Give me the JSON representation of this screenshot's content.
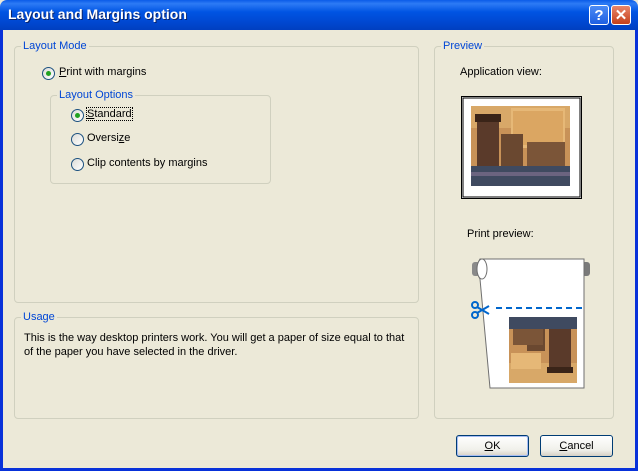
{
  "window": {
    "title": "Layout and Margins option",
    "help_glyph": "?",
    "close_glyph": "✕"
  },
  "layout_mode": {
    "legend": "Layout Mode",
    "print_with_margins": "Print with margins",
    "layout_options": {
      "legend": "Layout Options",
      "standard": "Standard",
      "oversize": "Oversize",
      "clip": "Clip contents by margins",
      "selected": "Standard"
    }
  },
  "usage": {
    "legend": "Usage",
    "text": "This is the way desktop printers work. You will get a paper of size equal to that of the paper you have selected in the driver."
  },
  "preview": {
    "legend": "Preview",
    "application_view": "Application view:",
    "print_preview": "Print preview:",
    "accent_blue": "#0066CC"
  },
  "buttons": {
    "ok": "OK",
    "cancel": "Cancel"
  }
}
